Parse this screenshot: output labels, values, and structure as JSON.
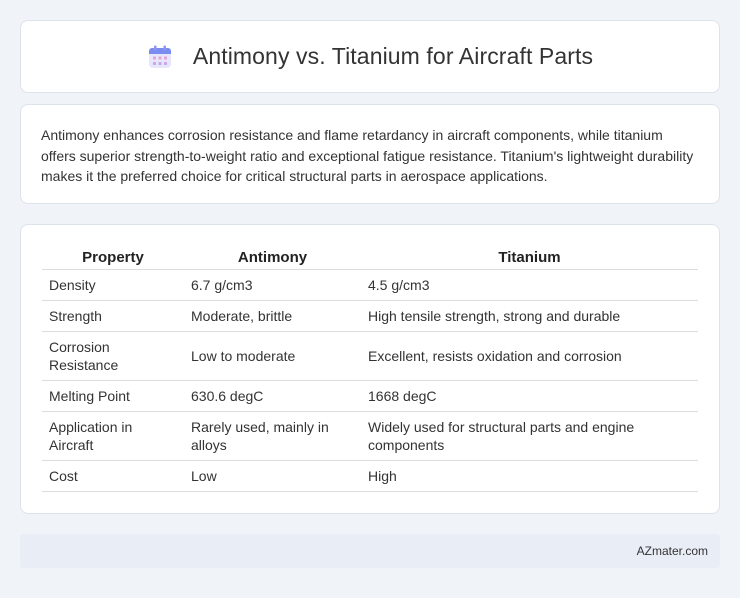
{
  "header": {
    "title": "Antimony vs. Titanium for Aircraft Parts",
    "icon": "calendar-icon"
  },
  "intro": {
    "text": "Antimony enhances corrosion resistance and flame retardancy in aircraft components, while titanium offers superior strength-to-weight ratio and exceptional fatigue resistance. Titanium's lightweight durability makes it the preferred choice for critical structural parts in aerospace applications."
  },
  "table": {
    "headers": [
      "Property",
      "Antimony",
      "Titanium"
    ],
    "rows": [
      [
        "Density",
        "6.7 g/cm3",
        "4.5 g/cm3"
      ],
      [
        "Strength",
        "Moderate, brittle",
        "High tensile strength, strong and durable"
      ],
      [
        "Corrosion Resistance",
        "Low to moderate",
        "Excellent, resists oxidation and corrosion"
      ],
      [
        "Melting Point",
        "630.6 degC",
        "1668 degC"
      ],
      [
        "Application in Aircraft",
        "Rarely used, mainly in alloys",
        "Widely used for structural parts and engine components"
      ],
      [
        "Cost",
        "Low",
        "High"
      ]
    ]
  },
  "footer": {
    "text": "AZmater.com"
  },
  "colors": {
    "background": "#f0f3f8",
    "card": "#ffffff",
    "footer": "#e8edf6",
    "icon_accent": "#7b8cf0"
  }
}
